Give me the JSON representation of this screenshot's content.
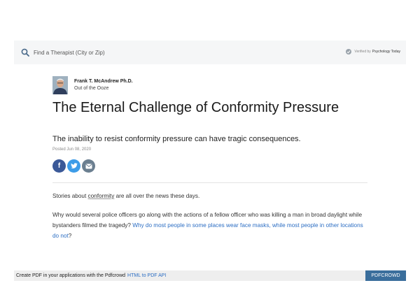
{
  "search": {
    "placeholder": "Find a Therapist (City or Zip)",
    "verified_prefix": "Verified by",
    "verified_brand": "Psychology Today"
  },
  "author": {
    "name": "Frank T. McAndrew Ph.D.",
    "blog": "Out of the Ooze"
  },
  "article": {
    "title": "The Eternal Challenge of Conformity Pressure",
    "subtitle": "The inability to resist conformity pressure can have tragic consequences.",
    "posted": "Posted Jun 08, 2020",
    "p1_before": "Stories about ",
    "p1_link": "conformity",
    "p1_after": " are all over the news these days.",
    "p2_text": "Why would several police officers go along with the actions of a fellow officer who was killing a man in broad daylight while bystanders filmed the tragedy? ",
    "p2_link": "Why do most people in some places wear face masks, while most people in other locations do not",
    "p2_end": "?"
  },
  "share": {
    "facebook_glyph": "f",
    "twitter_glyph": "t",
    "email_glyph": "✉"
  },
  "pdfbar": {
    "text": "Create PDF in your applications with the Pdfcrowd",
    "link": "HTML to PDF API",
    "button": "PDFCROWD"
  },
  "colors": {
    "link": "#2b6dc3",
    "facebook": "#3b5998",
    "twitter": "#3d9ce8",
    "email": "#6b7f90",
    "pdfcrowd": "#3a6e9c"
  }
}
